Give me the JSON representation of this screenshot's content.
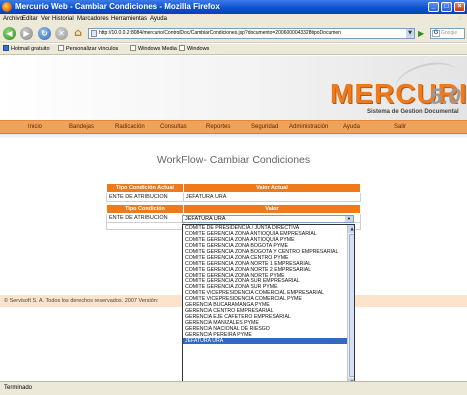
{
  "window": {
    "title": "Mercurio Web - Cambiar Condiciones - Mozilla Firefox",
    "min_glyph": "_",
    "max_glyph": "□",
    "close_glyph": "×"
  },
  "menu": [
    "Archivo",
    "Editar",
    "Ver",
    "Historial",
    "Marcadores",
    "Herramientas",
    "Ayuda"
  ],
  "toolbar": {
    "address": "http://10.0.0.2:8084/mercurio/ControlDoc/CambiarCondiciones.jsp?documento=2006000043328tipoDocumen",
    "search_placeholder": "Google",
    "search_engine_glyph": "G"
  },
  "bookmarks": [
    "Hotmail gratuito",
    "Personalizar vínculos",
    "Windows Media",
    "Windows"
  ],
  "logo": {
    "name": "MERCURIO",
    "tagline": "Sistema de Gestion Documental",
    "version": "5.0",
    "brand_color": "#ee7a1b"
  },
  "nav": [
    "Inicio",
    "Bandejas",
    "Radicación",
    "Consultas",
    "Reportes",
    "Seguridad",
    "Administración",
    "Ayuda",
    "Salir"
  ],
  "page_title": "WorkFlow- Cambiar Condiciones",
  "current_table": {
    "headers": [
      "Tipo Condición Actual",
      "Valor Actual"
    ],
    "row": [
      "ENTE DE ATRIBUCION",
      "JEFATURA URA"
    ]
  },
  "condition_table": {
    "headers": [
      "Tipo Condición",
      "Valor"
    ],
    "row_label": "ENTE DE ATRIBUCION",
    "selected_value": "JEFATURA URA"
  },
  "dropdown_options": [
    "COMITE DE PRESIDENCIA / JUNTA DIRECTIVA",
    "COMITE GERENCIA ZONA ANTIOQUIA EMPRESARIAL",
    "COMITE GERENCIA ZONA ANTIOQUIA PYME",
    "COMITE GERENCIA ZONA BOGOTA PYME",
    "COMITE GERENCIA ZONA BOGOTA Y CENTRO EMPRESARIAL",
    "COMITE GERENCIA ZONA CENTRO PYME",
    "COMITE GERENCIA ZONA NORTE 1 EMPRESARIAL",
    "COMITE GERENCIA ZONA NORTE 2 EMPRESARIAL",
    "COMITE GERENCIA ZONA NORTE PYME",
    "COMITE GERENCIA ZONA SUR EMPRESARIAL",
    "COMITE GERENCIA ZONA SUR PYME",
    "COMITE VICEPRESIDENCIA COMERCIAL EMPRESARIAL",
    "COMITE VICEPRESIDENCIA COMERCIAL PYME",
    "GERENCIA BUCARAMANGA PYME",
    "GERENCIA CENTRO EMPRESARIAL",
    "GERENCIA EJE CAFETERO EMPRESARIAL",
    "GERENCIA MANIZALES PYME",
    "GERENCIA NACIONAL DE RIESGO",
    "GERENCIA PEREIRA PYME",
    "JEFATURA URA"
  ],
  "footer": "© Servisoft S. A. Todos los derechos reservados. 2007 Versión:",
  "status": "Terminado",
  "icons": {
    "back": "◀",
    "forward": "▶",
    "reload": "↻",
    "stop": "✕",
    "home": "⌂",
    "go": "▶",
    "dropdown": "▼",
    "scroll_up": "▲",
    "scroll_down": "▼",
    "throbber": "◌"
  }
}
